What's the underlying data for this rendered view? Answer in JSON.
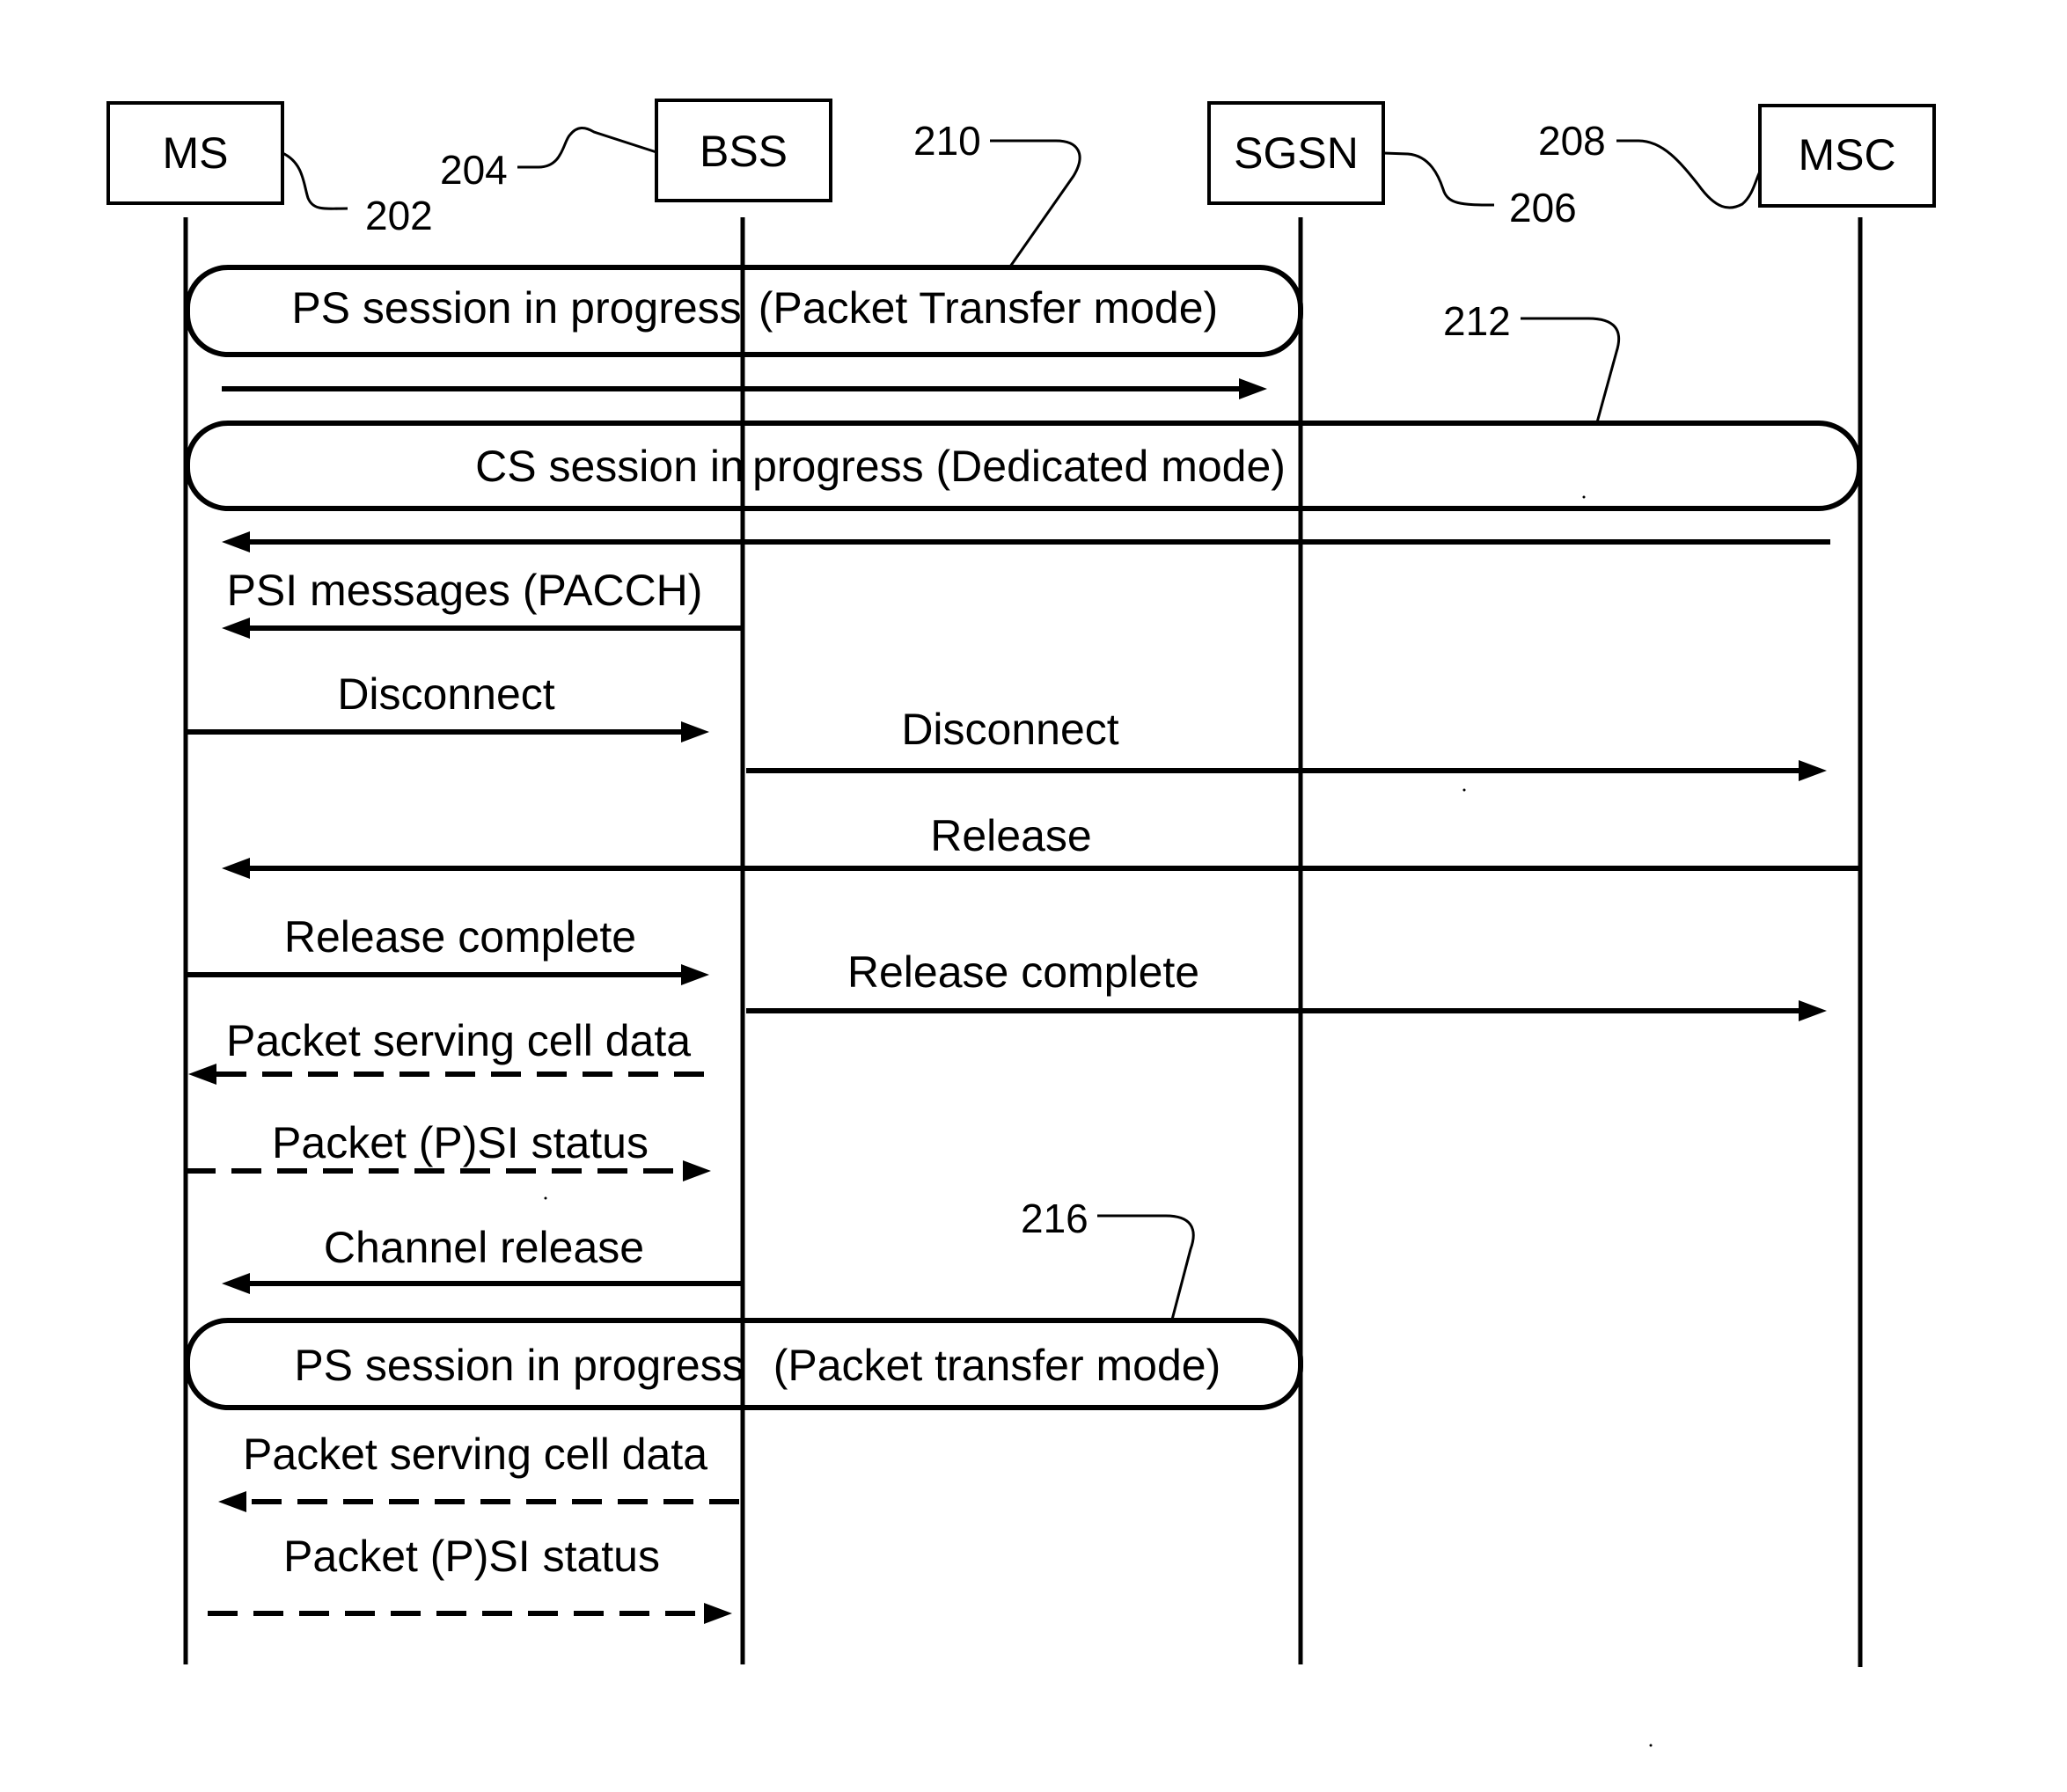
{
  "diagram": {
    "type": "sequence-diagram",
    "colors": {
      "ink": "#000000",
      "paper": "#ffffff"
    },
    "participants": [
      {
        "id": "ms",
        "label": "MS",
        "ref": "202"
      },
      {
        "id": "bss",
        "label": "BSS",
        "ref": "204"
      },
      {
        "id": "sgsn",
        "label": "SGSN",
        "ref": "206"
      },
      {
        "id": "msc",
        "label": "MSC",
        "ref": "208"
      }
    ],
    "sessions": [
      {
        "id": "ps1",
        "label_left": "PS session in progress",
        "label_right": "(Packet Transfer mode)",
        "from": "ms",
        "to": "sgsn",
        "ref": "210"
      },
      {
        "id": "cs",
        "label_left": "CS session in",
        "label_right": "progress (Dedicated mode)",
        "from": "ms",
        "to": "msc",
        "ref": "212"
      },
      {
        "id": "ps2",
        "label_left": "PS session in progress",
        "label_right": "(Packet transfer mode)",
        "from": "ms",
        "to": "sgsn",
        "ref": "216"
      }
    ],
    "messages": [
      {
        "id": "m1",
        "label": "",
        "from": "ms",
        "to": "sgsn",
        "style": "solid"
      },
      {
        "id": "m2",
        "label": "",
        "from": "msc",
        "to": "ms",
        "style": "solid"
      },
      {
        "id": "m3",
        "label": "PSI messages (PACCH)",
        "from": "bss",
        "to": "ms",
        "style": "solid"
      },
      {
        "id": "m4",
        "label": "Disconnect",
        "from": "ms",
        "to": "bss",
        "style": "solid"
      },
      {
        "id": "m5",
        "label": "Disconnect",
        "from": "bss",
        "to": "msc",
        "style": "solid"
      },
      {
        "id": "m6",
        "label": "Release",
        "from": "msc",
        "to": "ms",
        "style": "solid"
      },
      {
        "id": "m7",
        "label": "Release complete",
        "from": "ms",
        "to": "bss",
        "style": "solid"
      },
      {
        "id": "m8",
        "label": "Release complete",
        "from": "bss",
        "to": "msc",
        "style": "solid"
      },
      {
        "id": "m9",
        "label": "Packet serving cell data",
        "from": "bss",
        "to": "ms",
        "style": "dashed"
      },
      {
        "id": "m10",
        "label": "Packet (P)SI status",
        "from": "ms",
        "to": "bss",
        "style": "dashed"
      },
      {
        "id": "m11",
        "label": "Channel release",
        "from": "bss",
        "to": "ms",
        "style": "solid"
      },
      {
        "id": "m12",
        "label": "Packet serving cell data",
        "from": "bss",
        "to": "ms",
        "style": "dashed"
      },
      {
        "id": "m13",
        "label": "Packet (P)SI status",
        "from": "ms",
        "to": "bss",
        "style": "dashed"
      }
    ]
  }
}
